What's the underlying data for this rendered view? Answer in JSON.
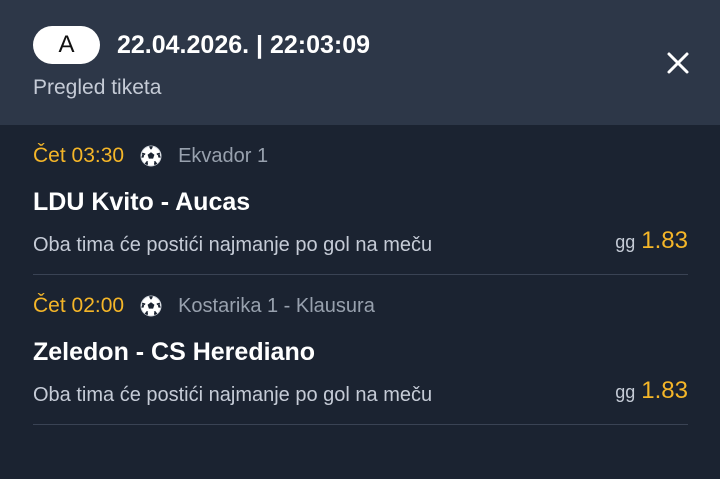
{
  "header": {
    "badge": "A",
    "datetime": "22.04.2026. | 22:03:09",
    "subtitle": "Pregled tiketa",
    "close_icon": "close-icon"
  },
  "matches": [
    {
      "time": "Čet 03:30",
      "sport_icon": "soccer-ball-icon",
      "league": "Ekvador 1",
      "teams": "LDU Kvito - Aucas",
      "market": "Oba tima će postići najmanje po gol na meču",
      "pick_code": "gg",
      "odd": "1.83"
    },
    {
      "time": "Čet 02:00",
      "sport_icon": "soccer-ball-icon",
      "league": "Kostarika 1 - Klausura",
      "teams": "Zeledon - CS Herediano",
      "market": "Oba tima će postići najmanje po gol na meču",
      "pick_code": "gg",
      "odd": "1.83"
    }
  ],
  "colors": {
    "background": "#1b2331",
    "header_background": "#2d3748",
    "accent": "#f5b628",
    "muted_text": "#98a1ae",
    "divider": "#3a4354"
  }
}
